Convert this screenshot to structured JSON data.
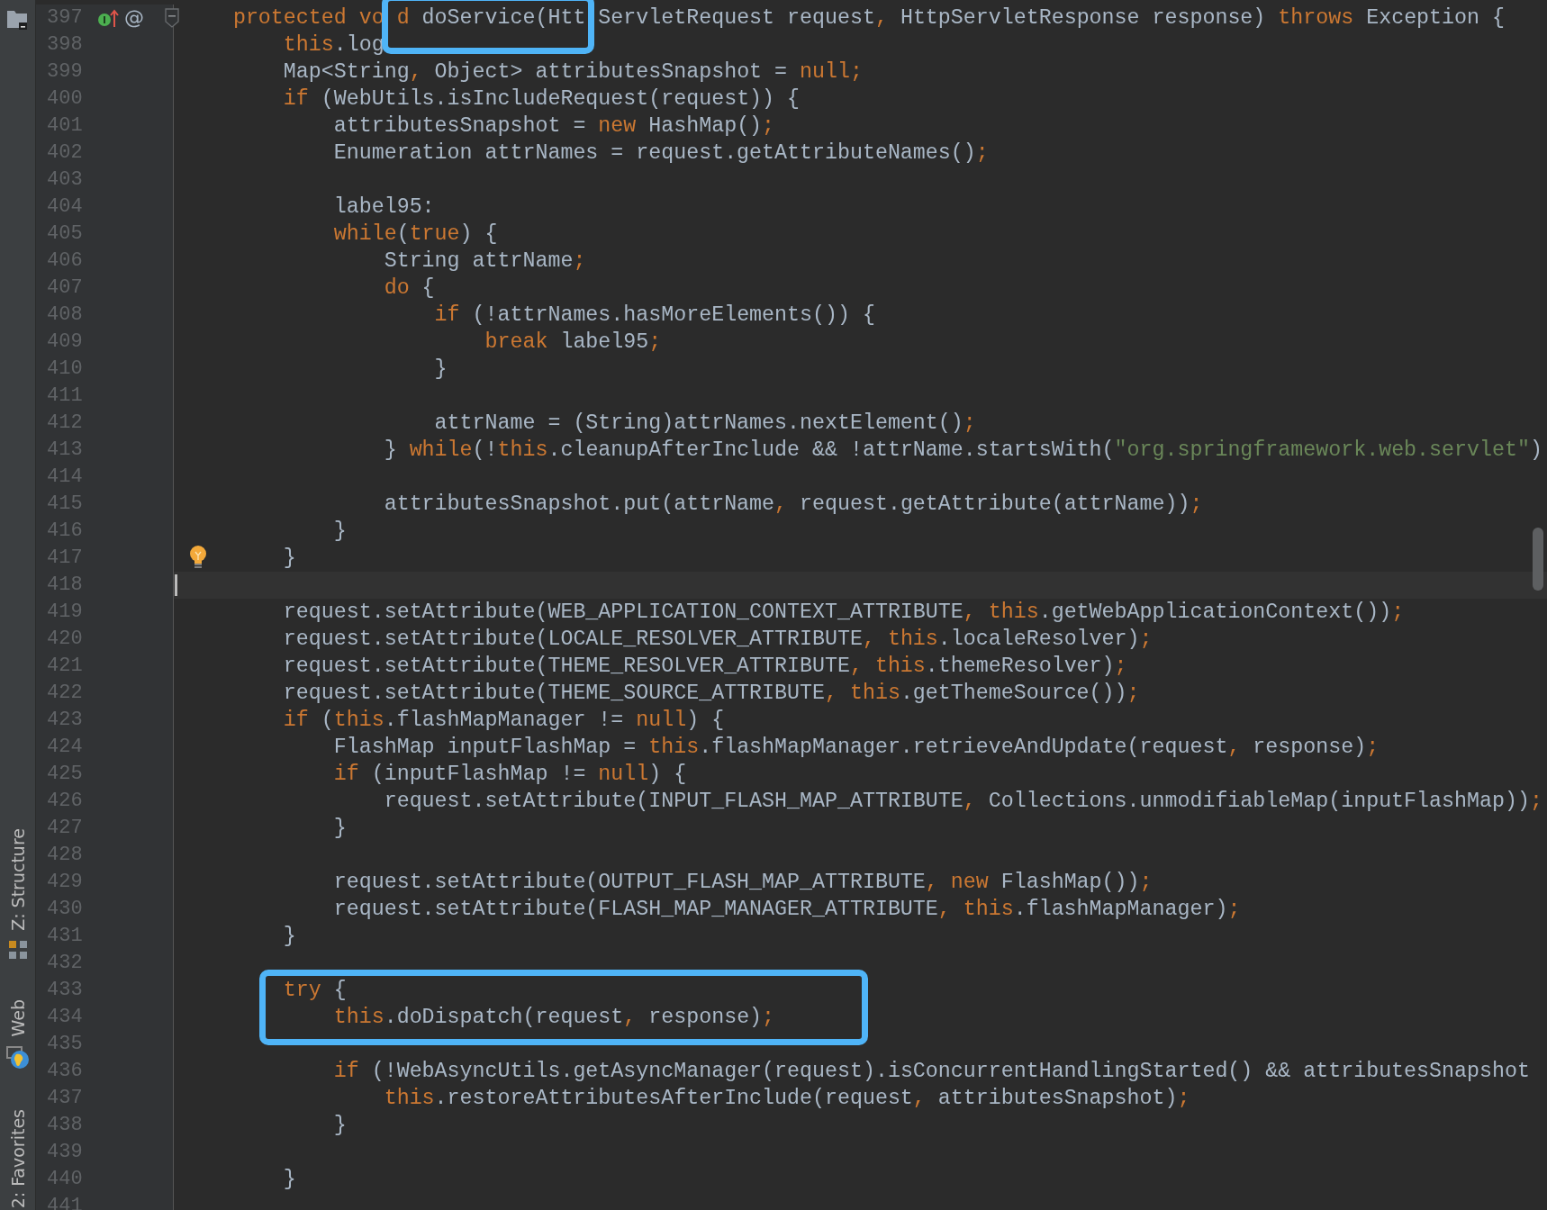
{
  "tool_windows": [
    {
      "kind": "project"
    },
    {
      "kind": "structure",
      "label": "Z: Structure"
    },
    {
      "kind": "web",
      "label": "Web"
    },
    {
      "kind": "favorites",
      "label": "2: Favorites"
    }
  ],
  "lines": [
    {
      "number": "397",
      "current": false,
      "marks": [
        {
          "kind": "implemented"
        },
        {
          "kind": "annotation",
          "text": "@"
        },
        {
          "kind": "fold"
        }
      ],
      "code": [
        {
          "kind": "keyword",
          "text": "    protected vo d"
        },
        {
          "kind": "plain",
          "text": " doService(Htt"
        },
        {
          "kind": "plain",
          "text": " ServletRequest request"
        },
        {
          "kind": "keyword",
          "text": ","
        },
        {
          "kind": "plain",
          "text": " HttpServletResponse response) "
        },
        {
          "kind": "keyword",
          "text": "throws"
        },
        {
          "kind": "plain",
          "text": " Exception {"
        }
      ]
    },
    {
      "number": "398",
      "current": false,
      "code": [
        {
          "kind": "keyword",
          "text": "        this"
        },
        {
          "kind": "plain",
          "text": ".log"
        }
      ]
    },
    {
      "number": "399",
      "current": false,
      "code": [
        {
          "kind": "plain",
          "text": "        Map<String"
        },
        {
          "kind": "keyword",
          "text": ","
        },
        {
          "kind": "plain",
          "text": " Object> attributesSnapshot = "
        },
        {
          "kind": "keyword",
          "text": "null;"
        }
      ]
    },
    {
      "number": "400",
      "current": false,
      "code": [
        {
          "kind": "keyword",
          "text": "        if"
        },
        {
          "kind": "plain",
          "text": " (WebUtils.isIncludeRequest(request)) {"
        }
      ]
    },
    {
      "number": "401",
      "current": false,
      "code": [
        {
          "kind": "plain",
          "text": "            attributesSnapshot = "
        },
        {
          "kind": "keyword",
          "text": "new"
        },
        {
          "kind": "plain",
          "text": " HashMap()"
        },
        {
          "kind": "keyword",
          "text": ";"
        }
      ]
    },
    {
      "number": "402",
      "current": false,
      "code": [
        {
          "kind": "plain",
          "text": "            Enumeration attrNames = request.getAttributeNames()"
        },
        {
          "kind": "keyword",
          "text": ";"
        }
      ]
    },
    {
      "number": "403",
      "current": false
    },
    {
      "number": "404",
      "current": false,
      "code": [
        {
          "kind": "plain",
          "text": "            label95:"
        }
      ]
    },
    {
      "number": "405",
      "current": false,
      "code": [
        {
          "kind": "keyword",
          "text": "            while"
        },
        {
          "kind": "plain",
          "text": "("
        },
        {
          "kind": "keyword",
          "text": "true"
        },
        {
          "kind": "plain",
          "text": ") {"
        }
      ]
    },
    {
      "number": "406",
      "current": false,
      "code": [
        {
          "kind": "plain",
          "text": "                String attrName"
        },
        {
          "kind": "keyword",
          "text": ";"
        }
      ]
    },
    {
      "number": "407",
      "current": false,
      "code": [
        {
          "kind": "keyword",
          "text": "                do"
        },
        {
          "kind": "plain",
          "text": " {"
        }
      ]
    },
    {
      "number": "408",
      "current": false,
      "code": [
        {
          "kind": "keyword",
          "text": "                    if"
        },
        {
          "kind": "plain",
          "text": " (!attrNames.hasMoreElements()) {"
        }
      ]
    },
    {
      "number": "409",
      "current": false,
      "code": [
        {
          "kind": "keyword",
          "text": "                        break"
        },
        {
          "kind": "plain",
          "text": " label95"
        },
        {
          "kind": "keyword",
          "text": ";"
        }
      ]
    },
    {
      "number": "410",
      "current": false,
      "code": [
        {
          "kind": "plain",
          "text": "                    }"
        }
      ]
    },
    {
      "number": "411",
      "current": false
    },
    {
      "number": "412",
      "current": false,
      "code": [
        {
          "kind": "plain",
          "text": "                    attrName = (String)attrNames.nextElement()"
        },
        {
          "kind": "keyword",
          "text": ";"
        }
      ]
    },
    {
      "number": "413",
      "current": false,
      "code": [
        {
          "kind": "plain",
          "text": "                } "
        },
        {
          "kind": "keyword",
          "text": "while"
        },
        {
          "kind": "plain",
          "text": "(!"
        },
        {
          "kind": "keyword",
          "text": "this"
        },
        {
          "kind": "plain",
          "text": ".cleanupAfterInclude && !attrName.startsWith("
        },
        {
          "kind": "string",
          "text": "\"org.springframework.web.servlet\""
        },
        {
          "kind": "plain",
          "text": ")"
        }
      ]
    },
    {
      "number": "414",
      "current": false
    },
    {
      "number": "415",
      "current": false,
      "code": [
        {
          "kind": "plain",
          "text": "                attributesSnapshot.put(attrName"
        },
        {
          "kind": "keyword",
          "text": ","
        },
        {
          "kind": "plain",
          "text": " request.getAttribute(attrName))"
        },
        {
          "kind": "keyword",
          "text": ";"
        }
      ]
    },
    {
      "number": "416",
      "current": false,
      "code": [
        {
          "kind": "plain",
          "text": "            }"
        }
      ]
    },
    {
      "number": "417",
      "current": false,
      "marks": [
        {
          "kind": "bulb"
        }
      ],
      "code": [
        {
          "kind": "plain",
          "text": "        }"
        }
      ]
    },
    {
      "number": "418",
      "current": true
    },
    {
      "number": "419",
      "current": false,
      "code": [
        {
          "kind": "plain",
          "text": "        request.setAttribute(WEB_APPLICATION_CONTEXT_ATTRIBUTE"
        },
        {
          "kind": "keyword",
          "text": ", this"
        },
        {
          "kind": "plain",
          "text": ".getWebApplicationContext())"
        },
        {
          "kind": "keyword",
          "text": ";"
        }
      ]
    },
    {
      "number": "420",
      "current": false,
      "code": [
        {
          "kind": "plain",
          "text": "        request.setAttribute(LOCALE_RESOLVER_ATTRIBUTE"
        },
        {
          "kind": "keyword",
          "text": ", this"
        },
        {
          "kind": "plain",
          "text": ".localeResolver)"
        },
        {
          "kind": "keyword",
          "text": ";"
        }
      ]
    },
    {
      "number": "421",
      "current": false,
      "code": [
        {
          "kind": "plain",
          "text": "        request.setAttribute(THEME_RESOLVER_ATTRIBUTE"
        },
        {
          "kind": "keyword",
          "text": ", this"
        },
        {
          "kind": "plain",
          "text": ".themeResolver)"
        },
        {
          "kind": "keyword",
          "text": ";"
        }
      ]
    },
    {
      "number": "422",
      "current": false,
      "code": [
        {
          "kind": "plain",
          "text": "        request.setAttribute(THEME_SOURCE_ATTRIBUTE"
        },
        {
          "kind": "keyword",
          "text": ", this"
        },
        {
          "kind": "plain",
          "text": ".getThemeSource())"
        },
        {
          "kind": "keyword",
          "text": ";"
        }
      ]
    },
    {
      "number": "423",
      "current": false,
      "code": [
        {
          "kind": "keyword",
          "text": "        if"
        },
        {
          "kind": "plain",
          "text": " ("
        },
        {
          "kind": "keyword",
          "text": "this"
        },
        {
          "kind": "plain",
          "text": ".flashMapManager != "
        },
        {
          "kind": "keyword",
          "text": "null"
        },
        {
          "kind": "plain",
          "text": ") {"
        }
      ]
    },
    {
      "number": "424",
      "current": false,
      "code": [
        {
          "kind": "plain",
          "text": "            FlashMap inputFlashMap = "
        },
        {
          "kind": "keyword",
          "text": "this"
        },
        {
          "kind": "plain",
          "text": ".flashMapManager.retrieveAndUpdate(request"
        },
        {
          "kind": "keyword",
          "text": ","
        },
        {
          "kind": "plain",
          "text": " response)"
        },
        {
          "kind": "keyword",
          "text": ";"
        }
      ]
    },
    {
      "number": "425",
      "current": false,
      "code": [
        {
          "kind": "keyword",
          "text": "            if"
        },
        {
          "kind": "plain",
          "text": " (inputFlashMap != "
        },
        {
          "kind": "keyword",
          "text": "null"
        },
        {
          "kind": "plain",
          "text": ") {"
        }
      ]
    },
    {
      "number": "426",
      "current": false,
      "code": [
        {
          "kind": "plain",
          "text": "                request.setAttribute(INPUT_FLASH_MAP_ATTRIBUTE"
        },
        {
          "kind": "keyword",
          "text": ","
        },
        {
          "kind": "plain",
          "text": " Collections.unmodifiableMap(inputFlashMap))"
        },
        {
          "kind": "keyword",
          "text": ";"
        }
      ]
    },
    {
      "number": "427",
      "current": false,
      "code": [
        {
          "kind": "plain",
          "text": "            }"
        }
      ]
    },
    {
      "number": "428",
      "current": false
    },
    {
      "number": "429",
      "current": false,
      "code": [
        {
          "kind": "plain",
          "text": "            request.setAttribute(OUTPUT_FLASH_MAP_ATTRIBUTE"
        },
        {
          "kind": "keyword",
          "text": ", new"
        },
        {
          "kind": "plain",
          "text": " FlashMap())"
        },
        {
          "kind": "keyword",
          "text": ";"
        }
      ]
    },
    {
      "number": "430",
      "current": false,
      "code": [
        {
          "kind": "plain",
          "text": "            request.setAttribute(FLASH_MAP_MANAGER_ATTRIBUTE"
        },
        {
          "kind": "keyword",
          "text": ", this"
        },
        {
          "kind": "plain",
          "text": ".flashMapManager)"
        },
        {
          "kind": "keyword",
          "text": ";"
        }
      ]
    },
    {
      "number": "431",
      "current": false,
      "code": [
        {
          "kind": "plain",
          "text": "        }"
        }
      ]
    },
    {
      "number": "432",
      "current": false
    },
    {
      "number": "433",
      "current": false,
      "code": [
        {
          "kind": "keyword",
          "text": "        try"
        },
        {
          "kind": "plain",
          "text": " {"
        }
      ]
    },
    {
      "number": "434",
      "current": false,
      "code": [
        {
          "kind": "keyword",
          "text": "            this"
        },
        {
          "kind": "plain",
          "text": ".doDispatch(request"
        },
        {
          "kind": "keyword",
          "text": ","
        },
        {
          "kind": "plain",
          "text": " response)"
        },
        {
          "kind": "keyword",
          "text": ";"
        }
      ]
    },
    {
      "number": "435",
      "current": false
    },
    {
      "number": "436",
      "current": false,
      "code": [
        {
          "kind": "keyword",
          "text": "            if"
        },
        {
          "kind": "plain",
          "text": " (!WebAsyncUtils.getAsyncManager(request).isConcurrentHandlingStarted() && attributesSnapshot"
        }
      ]
    },
    {
      "number": "437",
      "current": false,
      "code": [
        {
          "kind": "keyword",
          "text": "                this"
        },
        {
          "kind": "plain",
          "text": ".restoreAttributesAfterInclude(request"
        },
        {
          "kind": "keyword",
          "text": ","
        },
        {
          "kind": "plain",
          "text": " attributesSnapshot)"
        },
        {
          "kind": "keyword",
          "text": ";"
        }
      ]
    },
    {
      "number": "438",
      "current": false,
      "code": [
        {
          "kind": "plain",
          "text": "            }"
        }
      ]
    },
    {
      "number": "439",
      "current": false
    },
    {
      "number": "440",
      "current": false,
      "code": [
        {
          "kind": "plain",
          "text": "        }"
        }
      ]
    },
    {
      "number": "441",
      "current": false
    }
  ]
}
